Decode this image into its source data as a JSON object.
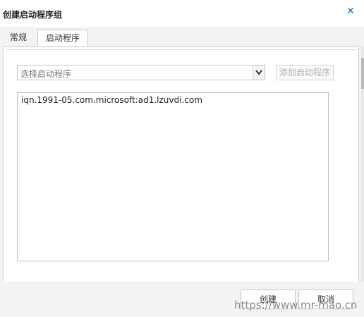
{
  "dialog": {
    "title": "创建启动程序组",
    "close_glyph": "✕",
    "close_icon": "close-icon",
    "accent_color": "#1f6fb2"
  },
  "tabs": [
    {
      "label": "常规",
      "active": false
    },
    {
      "label": "启动程序",
      "active": true
    }
  ],
  "initiator_select": {
    "placeholder": "选择启动程序",
    "arrow_icon": "chevron-down-icon"
  },
  "add_button": {
    "label": "添加启动程序",
    "enabled": false
  },
  "initiator_list": {
    "items": [
      "iqn.1991-05.com.microsoft:ad1.lzuvdi.com"
    ]
  },
  "footer": {
    "create_label": "创建",
    "cancel_label": "取消"
  },
  "watermark": "https://www.mr-mao.cn"
}
